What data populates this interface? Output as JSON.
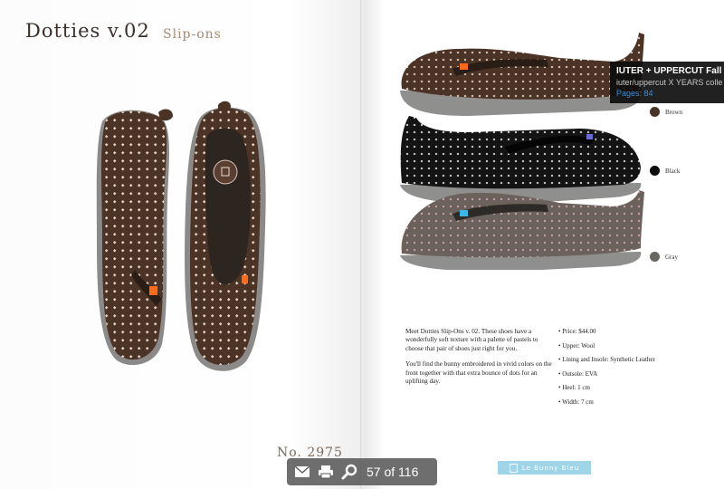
{
  "left_page": {
    "title": "Dotties v.02",
    "subtitle": "Slip-ons",
    "product_number": "No. 2975"
  },
  "right_page": {
    "colors": [
      {
        "label": "Brown",
        "swatch": "#4a3426"
      },
      {
        "label": "Black",
        "swatch": "#0b0b0b"
      },
      {
        "label": "Gray",
        "swatch": "#6a6663"
      }
    ],
    "description": [
      "Meet Dotties Slip-Ons v. 02. These shoes have a wonderfully soft texture with a palette of pastels to choose that pair of shoes just right for you.",
      "You'll find the bunny embroidered in vivid colors on the front together with that extra bounce of dots for an uplifting day."
    ],
    "specs": [
      "Price: $44.00",
      "Upper: Wool",
      "Lining and Insole: Synthetic Leather",
      "Outsole: EVA",
      "Heel: 1 cm",
      "Width: 7 cm"
    ],
    "brand": {
      "name": "Le Bunny Bleu",
      "color": "#9fd4e9"
    }
  },
  "tooltip": {
    "title": "IUTER + UPPERCUT Fall wint",
    "subtitle": "iuter/uppercut X YEARS colle",
    "pages": "Pages: 84"
  },
  "toolbar": {
    "current_page": "57",
    "of_label": "of",
    "total_pages": "116",
    "icons": [
      "mail-icon",
      "print-icon",
      "search-icon"
    ]
  },
  "shoe_colors": {
    "brown": "#4b3326",
    "black": "#141414",
    "gray": "#6b625c",
    "sole": "#8d8d8b",
    "dot_brown": "#e8d8cc",
    "dot_black": "#e3e0e0",
    "dot_gray": "#d9a9b6"
  }
}
